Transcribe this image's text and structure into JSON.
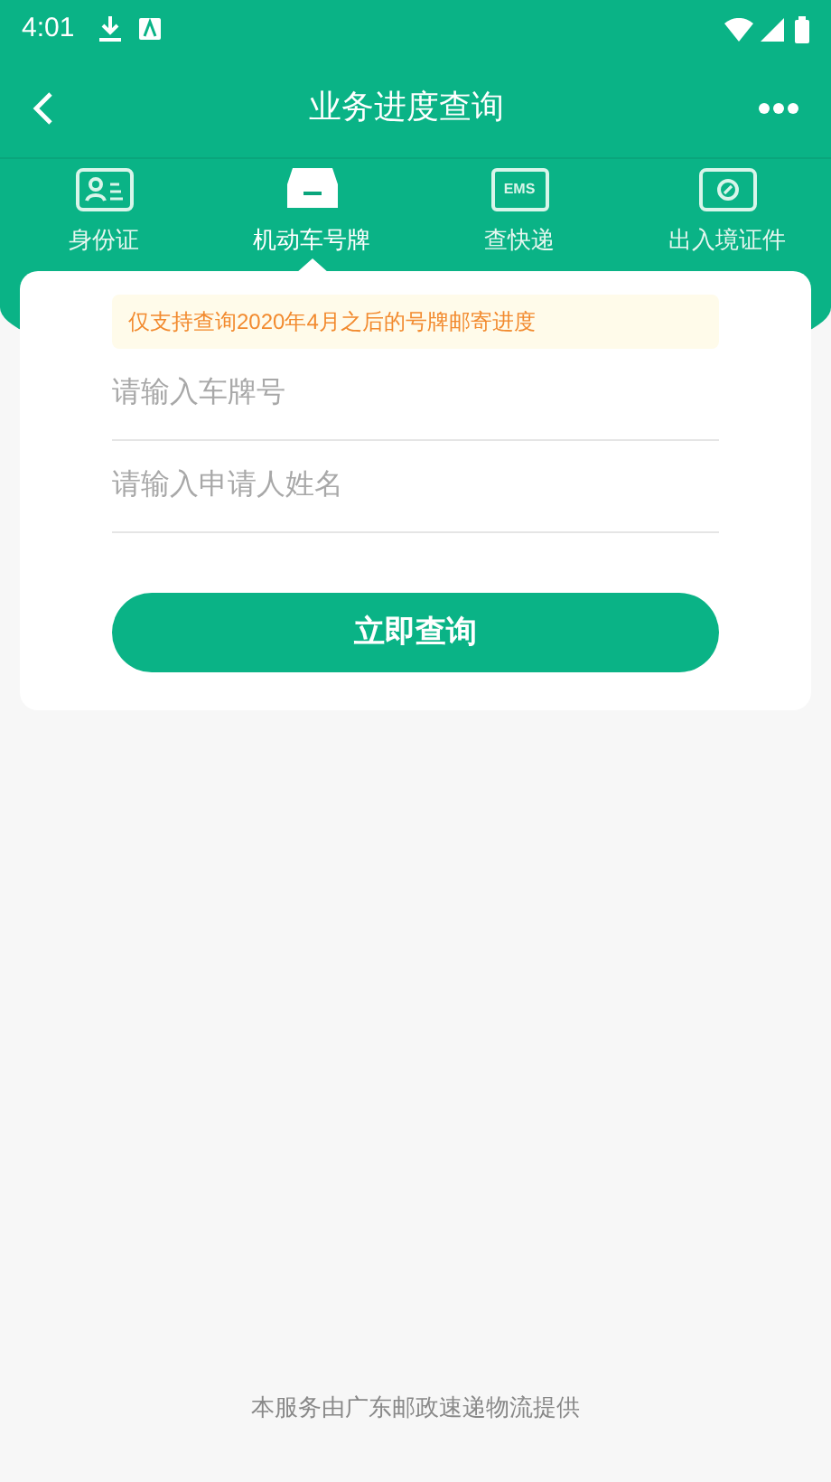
{
  "status_bar": {
    "time": "4:01"
  },
  "title_bar": {
    "title": "业务进度查询"
  },
  "tabs": [
    {
      "label": "身份证",
      "kind": "id",
      "selected": false
    },
    {
      "label": "机动车号牌",
      "kind": "car",
      "selected": true
    },
    {
      "label": "查快递",
      "kind": "ems",
      "icon_text": "EMS",
      "selected": false
    },
    {
      "label": "出入境证件",
      "kind": "passport",
      "selected": false
    }
  ],
  "notice": "仅支持查询2020年4月之后的号牌邮寄进度",
  "fields": [
    {
      "placeholder": "请输入车牌号"
    },
    {
      "placeholder": "请输入申请人姓名"
    }
  ],
  "submit": "立即查询",
  "footer": "本服务由广东邮政速递物流提供"
}
